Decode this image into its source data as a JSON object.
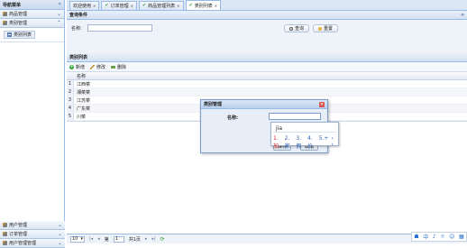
{
  "nav": {
    "title": "导航菜单",
    "sections_top": [
      {
        "label": "商品管理"
      },
      {
        "label": "类别管理",
        "child": "类别列表"
      }
    ],
    "sections_bottom": [
      {
        "label": "用户管理"
      },
      {
        "label": "订单管理"
      },
      {
        "label": "用户管理管理"
      }
    ]
  },
  "tabs": [
    {
      "label": "欢迎使用",
      "icon": "none"
    },
    {
      "label": "订单管理",
      "icon": "check-icon"
    },
    {
      "label": "商品管理列表",
      "icon": "check-icon"
    },
    {
      "label": "类别列表",
      "icon": "check-icon",
      "active": true
    }
  ],
  "query": {
    "title": "查询条件",
    "name_label": "名称:",
    "name_value": "",
    "search_label": "查询",
    "reset_label": "重置"
  },
  "list": {
    "title": "类别列表",
    "add_label": "新增",
    "edit_label": "修改",
    "delete_label": "删除",
    "column_header": "名称",
    "rows": [
      {
        "num": "1",
        "name": "江西菜"
      },
      {
        "num": "2",
        "name": "湘菜菜"
      },
      {
        "num": "3",
        "name": "江苏菜"
      },
      {
        "num": "4",
        "name": "广东菜"
      },
      {
        "num": "5",
        "name": "川菜"
      }
    ]
  },
  "pager": {
    "page_size": "10",
    "page_label": "第",
    "page_value": "1",
    "total_label": "共1页"
  },
  "dialog": {
    "title": "类别管理",
    "name_label": "名称:",
    "name_value": "",
    "save_label": "保存",
    "cancel_label": "取消"
  },
  "ime": {
    "pinyin": "jia",
    "candidates": [
      "1.加",
      "2.家",
      "3.假",
      "4.价",
      "5.+"
    ],
    "nav": "‹ ›"
  },
  "tray": {
    "items": [
      "中",
      "♪",
      "☼",
      "☺",
      "▦"
    ]
  },
  "colors": {
    "accent": "#99bbe8",
    "header_bg": "#dbe6f4",
    "check_green": "#3a9a2a",
    "close_red": "#d9534f"
  }
}
